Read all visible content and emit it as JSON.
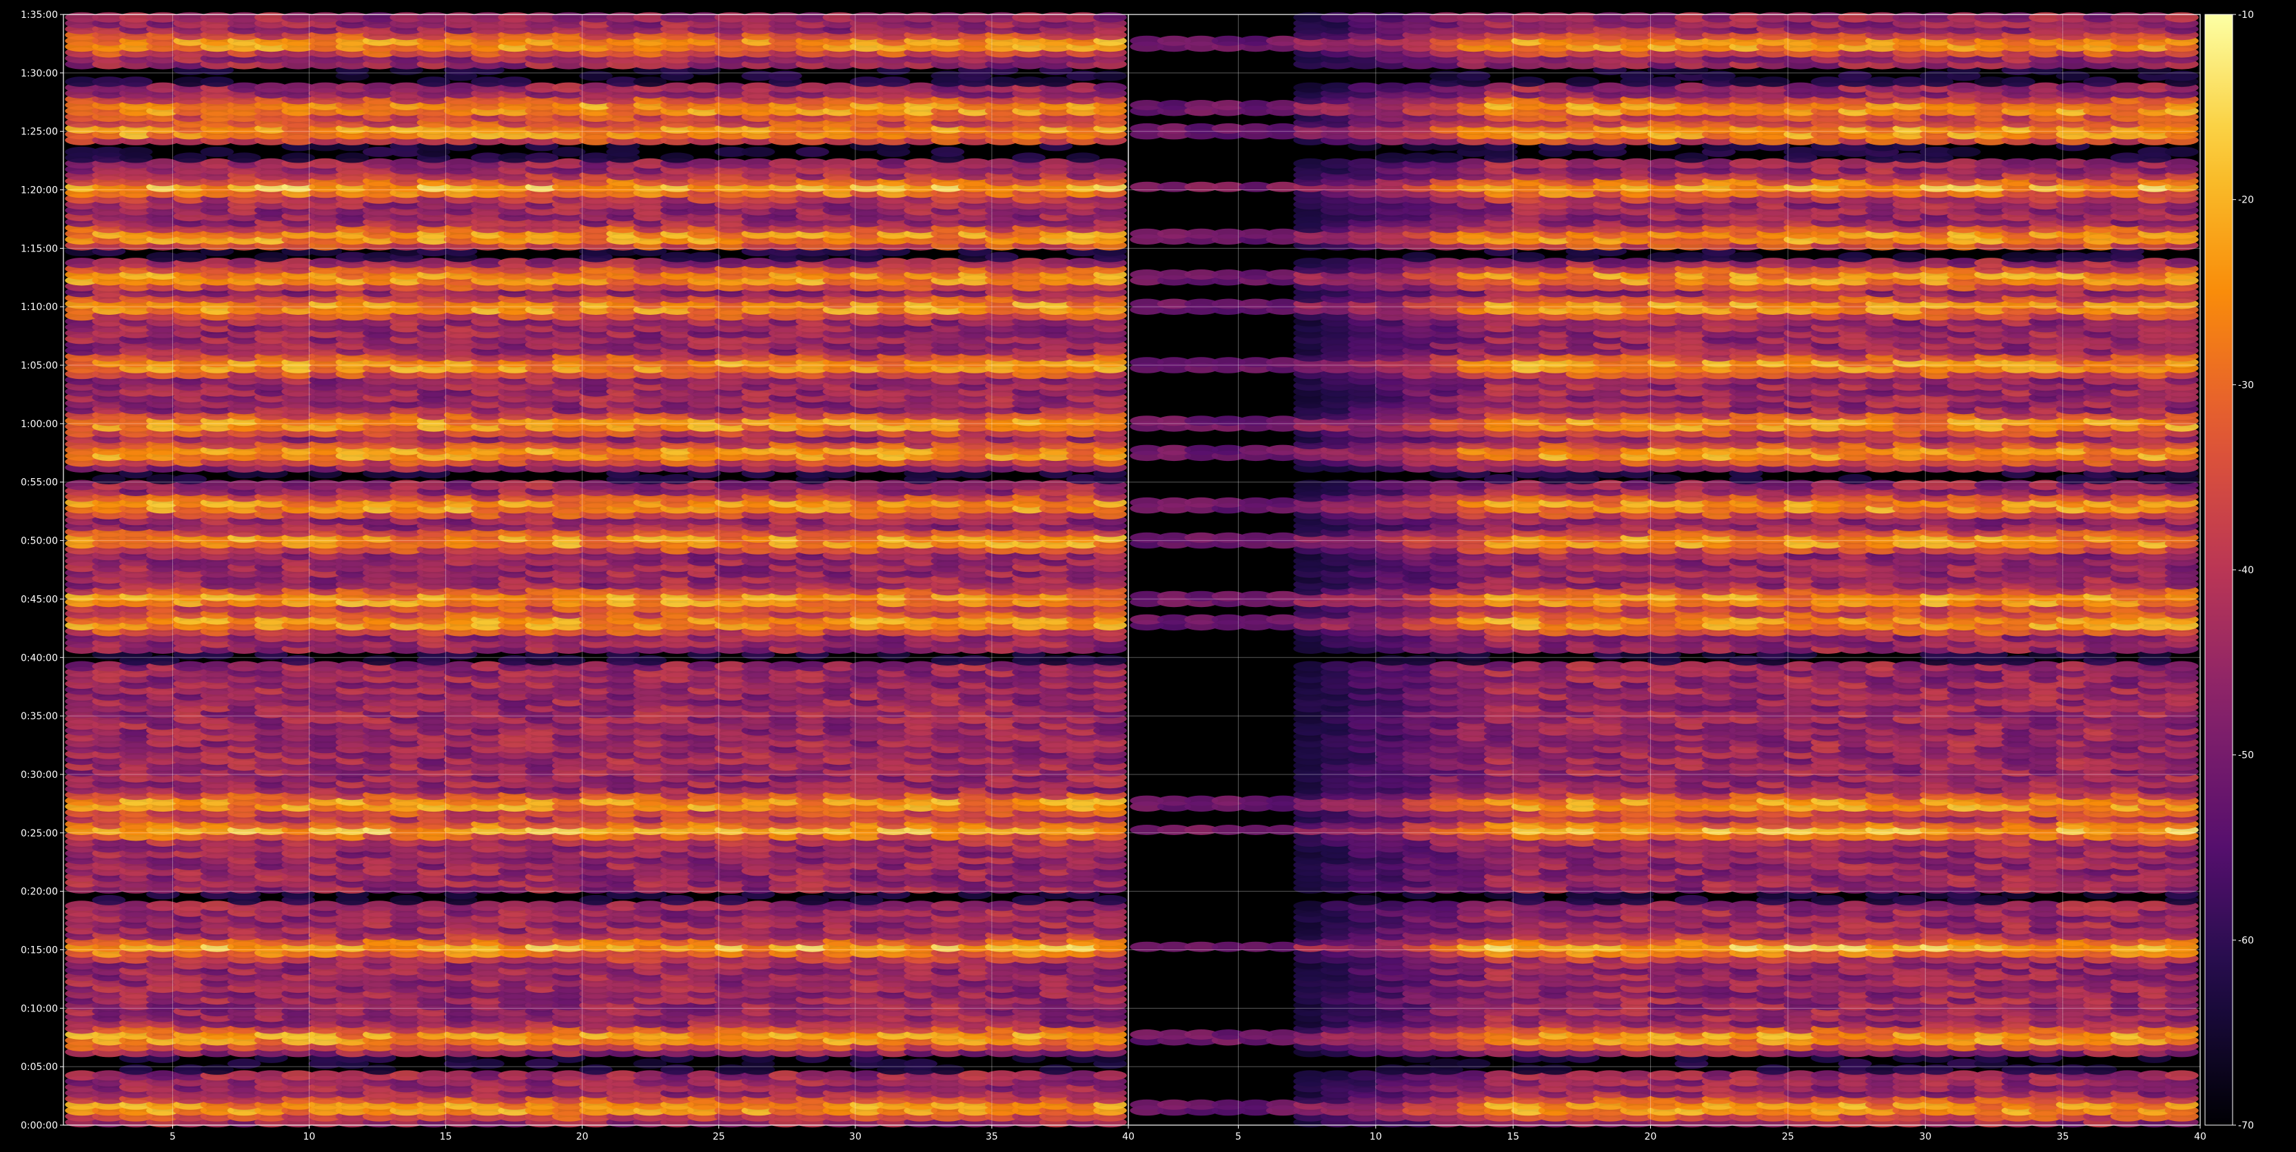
{
  "chart_data": {
    "type": "heatmap",
    "title": "",
    "xlabel": "",
    "ylabel": "",
    "grid": true,
    "panels": [
      {
        "name": "",
        "xlim": [
          1,
          40
        ],
        "x_ticks": [
          "5",
          "10",
          "15",
          "20",
          "25",
          "30",
          "35",
          "40"
        ],
        "x_tick_values": [
          5,
          10,
          15,
          20,
          25,
          30,
          35,
          40
        ]
      },
      {
        "name": "",
        "xlim": [
          1,
          40
        ],
        "x_ticks": [
          "5",
          "10",
          "15",
          "20",
          "25",
          "30",
          "35",
          "40"
        ],
        "x_tick_values": [
          5,
          10,
          15,
          20,
          25,
          30,
          35,
          40
        ]
      }
    ],
    "y_ticks": [
      "0:00:00",
      "0:05:00",
      "0:10:00",
      "0:15:00",
      "0:20:00",
      "0:25:00",
      "0:30:00",
      "0:35:00",
      "0:40:00",
      "0:45:00",
      "0:50:00",
      "0:55:00",
      "1:00:00",
      "1:05:00",
      "1:10:00",
      "1:15:00",
      "1:20:00",
      "1:25:00",
      "1:30:00",
      "1:35:00"
    ],
    "ylim_minutes": [
      0,
      95
    ],
    "colorbar": {
      "colormap": "inferno",
      "range": [
        -70,
        -10
      ],
      "ticks": [
        "-70",
        "-60",
        "-50",
        "-40",
        "-30",
        "-20",
        "-10"
      ],
      "tick_values": [
        -70,
        -60,
        -50,
        -40,
        -30,
        -20,
        -10
      ]
    },
    "time_step_minutes": 1,
    "columns_per_panel": 39,
    "bright_rows_minutes": [
      1.5,
      7.5,
      15.2,
      25.3,
      27.5,
      43,
      45,
      50,
      53,
      57.5,
      60,
      65,
      70,
      72.5,
      76,
      80.2,
      85,
      87,
      92.5
    ],
    "dark_gaps_minutes": [
      5.3,
      19.5,
      40,
      55.5,
      74.5,
      83.2,
      89.7
    ]
  }
}
